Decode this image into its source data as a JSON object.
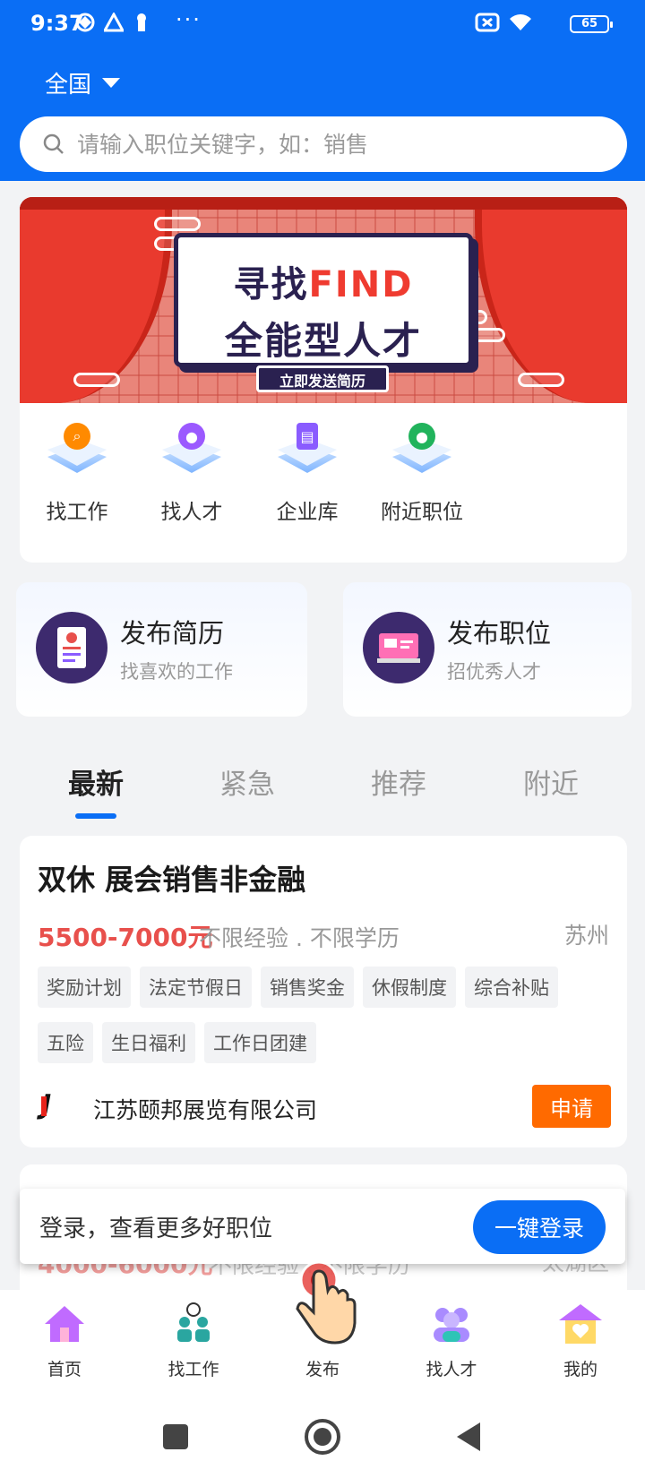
{
  "status_bar": {
    "time": "9:37",
    "battery": "65"
  },
  "header": {
    "region": "全国"
  },
  "search": {
    "placeholder": "请输入职位关键字，如：销售"
  },
  "banner": {
    "line1_cn": "寻找",
    "line1_en": "FIND",
    "line2": "全能型人才",
    "button": "立即发送简历"
  },
  "quick_links": [
    {
      "label": "找工作",
      "icon": "magnifier-icon",
      "color": "#ff8a00"
    },
    {
      "label": "找人才",
      "icon": "person-icon",
      "color": "#9b59ff"
    },
    {
      "label": "企业库",
      "icon": "book-icon",
      "color": "#8a5cff"
    },
    {
      "label": "附近职位",
      "icon": "location-pin-icon",
      "color": "#21b35c"
    }
  ],
  "publish": [
    {
      "title": "发布简历",
      "subtitle": "找喜欢的工作",
      "icon": "resume-icon"
    },
    {
      "title": "发布职位",
      "subtitle": "招优秀人才",
      "icon": "monitor-icon"
    }
  ],
  "tabs": [
    {
      "label": "最新",
      "active": true
    },
    {
      "label": "紧急",
      "active": false
    },
    {
      "label": "推荐",
      "active": false
    },
    {
      "label": "附近",
      "active": false
    }
  ],
  "jobs": [
    {
      "title": "双休 展会销售非金融",
      "salary": "5500-7000元",
      "requirements": "不限经验 . 不限学历",
      "city": "苏州",
      "tags": [
        "奖励计划",
        "法定节假日",
        "销售奖金",
        "休假制度",
        "综合补贴",
        "五险",
        "生日福利",
        "工作日团建"
      ],
      "company": "江苏颐邦展览有限公司",
      "apply_label": "申请"
    },
    {
      "salary": "4000-6000元",
      "requirements": "不限经验 . 不限学历",
      "city": "太湖区"
    }
  ],
  "login_prompt": {
    "text": "登录，查看更多好职位",
    "button": "一键登录"
  },
  "bottom_nav": [
    {
      "label": "首页",
      "icon": "home-icon"
    },
    {
      "label": "找工作",
      "icon": "job-seekers-icon"
    },
    {
      "label": "发布",
      "icon": "publish-icon"
    },
    {
      "label": "找人才",
      "icon": "talent-group-icon"
    },
    {
      "label": "我的",
      "icon": "profile-house-icon"
    }
  ],
  "colors": {
    "primary": "#0a6ef5",
    "salary": "#e8504c",
    "apply": "#ff6a00"
  }
}
